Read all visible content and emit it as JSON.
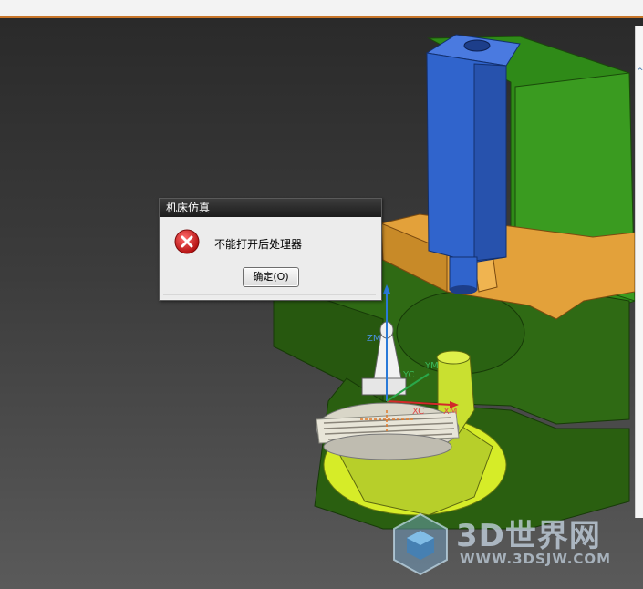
{
  "dialog": {
    "title": "机床仿真",
    "message": "不能打开后处理器",
    "ok_label": "确定(O)"
  },
  "scene": {
    "axis_labels": {
      "zm": "ZM",
      "ym": "YM",
      "xc": "XC",
      "xm": "XM",
      "yc": "YC"
    }
  },
  "watermark": {
    "title": "3D世界网",
    "url": "WWW.3DSJW.COM"
  },
  "colors": {
    "spindle_blue": "#2f5fc4",
    "frame_green": "#2f7d1a",
    "table_yellow": "#c8e23a",
    "base_dark_green": "#2a5a12",
    "tool_orange": "#e0a23a",
    "error_red": "#d21f1f"
  },
  "icons": [
    "error-icon",
    "cube-logo-icon"
  ]
}
